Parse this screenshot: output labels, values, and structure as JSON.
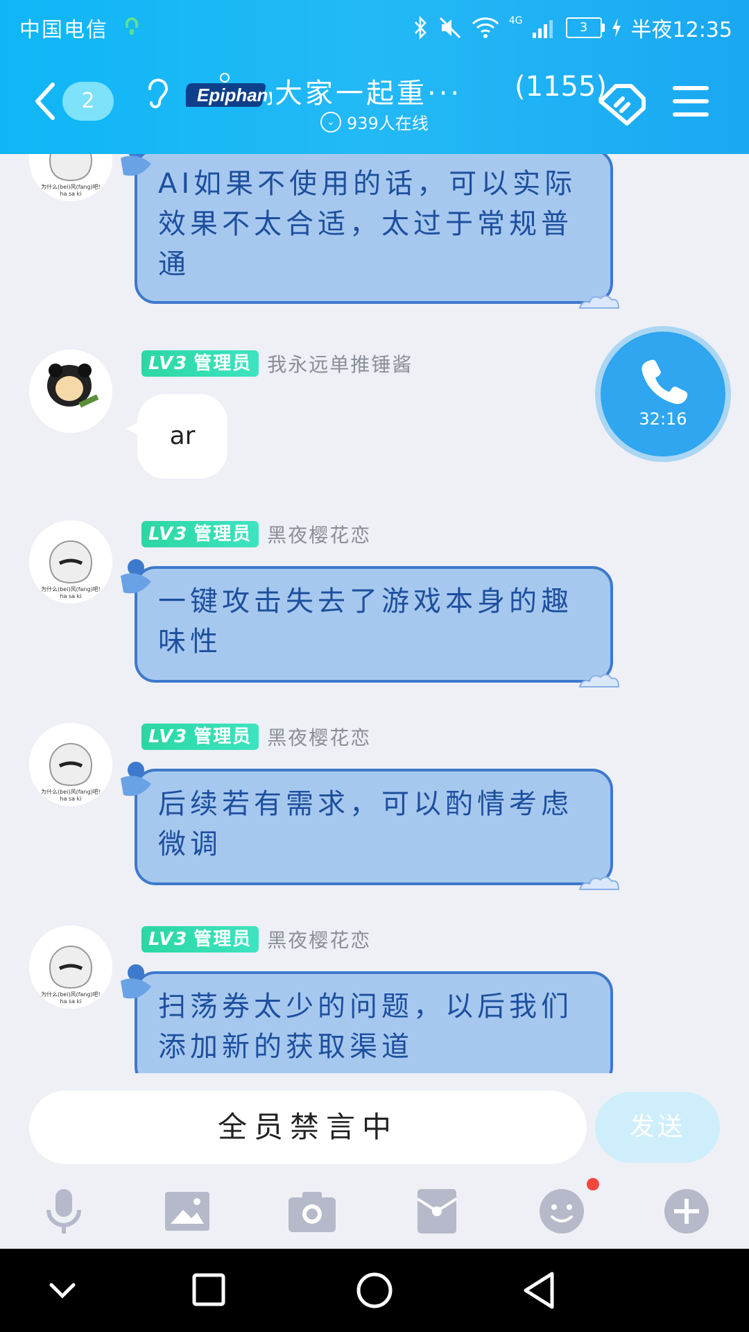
{
  "status_bar": {
    "carrier": "中国电信",
    "battery": "3",
    "net": "4G",
    "time": "半夜12:35"
  },
  "header": {
    "unread_badge": "2",
    "logo_text": "Epiphany",
    "title": "大家一起重···",
    "member_count": "(1155)",
    "online_text": "939人在线"
  },
  "messages": [
    {
      "text": "AI如果不使用的话，可以实际效果不太合适，太过于常规普通"
    },
    {
      "tag_level": "LV3",
      "tag_role": "管理员",
      "username": "我永远单推锤酱",
      "text": "ar"
    },
    {
      "tag_level": "LV3",
      "tag_role": "管理员",
      "username": "黑夜樱花恋",
      "text": "一键攻击失去了游戏本身的趣味性"
    },
    {
      "tag_level": "LV3",
      "tag_role": "管理员",
      "username": "黑夜樱花恋",
      "text": "后续若有需求，可以酌情考虑微调"
    },
    {
      "tag_level": "LV3",
      "tag_role": "管理员",
      "username": "黑夜樱花恋",
      "text": "扫荡券太少的问题，以后我们添加新的获取渠道"
    }
  ],
  "avatar_caption": {
    "line1": "为什么(bei)风(fang)吧!",
    "line2": "ha sa ki"
  },
  "call": {
    "duration": "32:16"
  },
  "input": {
    "muted_text": "全员禁言中",
    "send_label": "发送"
  },
  "toolbar_icons": [
    "microphone-icon",
    "image-icon",
    "camera-icon",
    "red-packet-icon",
    "emoji-icon",
    "plus-icon"
  ],
  "colors": {
    "header": "#1bb4f5",
    "bubble_fill": "#a7c8ee",
    "bubble_border": "#3d79cc",
    "bubble_text": "#1d4f9e",
    "admin_tag": "#2bd7a3",
    "notification_dot": "#f2473e"
  }
}
